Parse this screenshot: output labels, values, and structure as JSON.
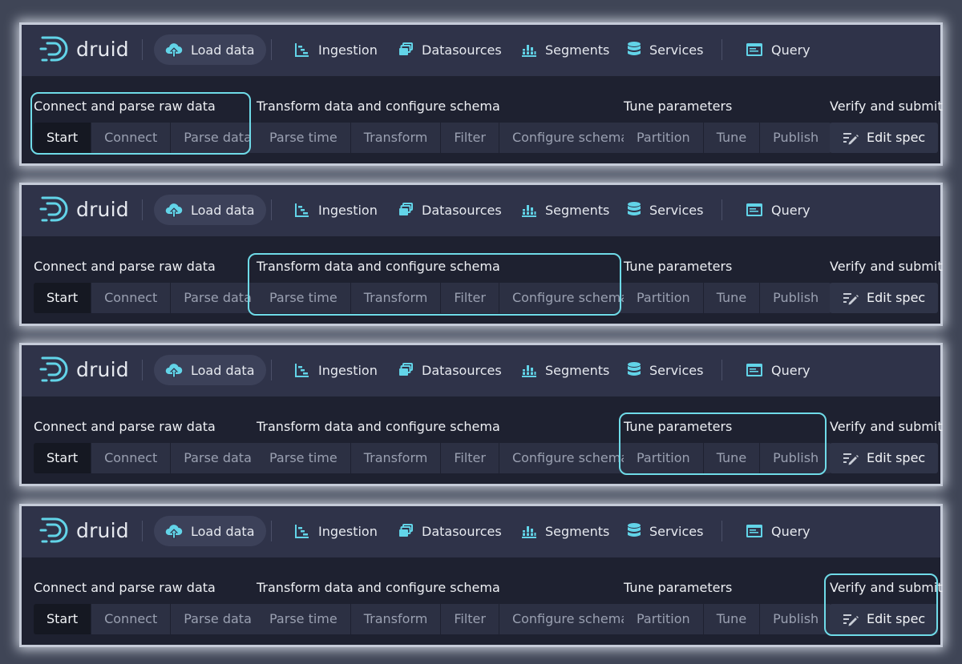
{
  "brand": {
    "name": "druid",
    "accent": "#62d4e8"
  },
  "nav": {
    "items": [
      {
        "label": "Load data",
        "icon": "cloud-upload-icon",
        "active": true
      },
      {
        "label": "Ingestion",
        "icon": "gantt-chart-icon"
      },
      {
        "label": "Datasources",
        "icon": "multi-select-icon"
      },
      {
        "label": "Segments",
        "icon": "stacked-chart-icon"
      },
      {
        "label": "Services",
        "icon": "database-icon"
      },
      {
        "label": "Query",
        "icon": "application-icon"
      }
    ]
  },
  "steps": {
    "groups": [
      {
        "title": "Connect and parse raw data",
        "buttons": [
          "Start",
          "Connect",
          "Parse data"
        ]
      },
      {
        "title": "Transform data and configure schema",
        "buttons": [
          "Parse time",
          "Transform",
          "Filter",
          "Configure schema"
        ]
      },
      {
        "title": "Tune parameters",
        "buttons": [
          "Partition",
          "Tune",
          "Publish"
        ]
      },
      {
        "title": "Verify and submit",
        "buttons": [
          "Edit spec"
        ],
        "icon": "edit-spec-icon"
      }
    ],
    "current_step": "Start"
  },
  "panels": [
    {
      "highlighted_group": "Connect and parse raw data"
    },
    {
      "highlighted_group": "Transform data and configure schema"
    },
    {
      "highlighted_group": "Tune parameters"
    },
    {
      "highlighted_group": "Verify and submit"
    }
  ],
  "colors": {
    "background": "#3f4556",
    "panel": "#1e2130",
    "navbar": "#2f3349",
    "highlight": "#6fdbe8",
    "button": "#2c3043",
    "button_current": "#151822"
  }
}
